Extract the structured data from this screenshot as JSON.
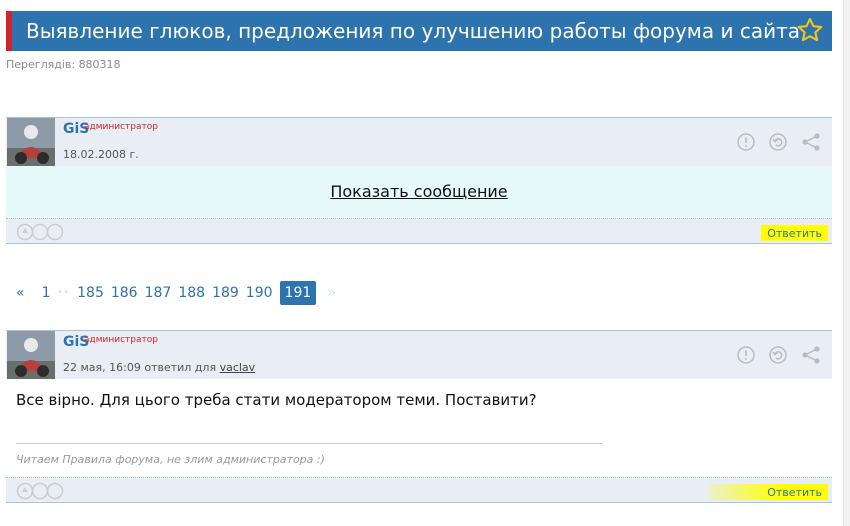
{
  "topic": {
    "title": "Выявление глюков, предложения по улучшению работы форума и сайта",
    "views_label": "Переглядів: 880318"
  },
  "posts": [
    {
      "author": "GiS",
      "role": "администратор",
      "date": "18.02.2008 г.",
      "show_message": "Показать сообщение",
      "reply_label": "Ответить"
    },
    {
      "author": "GiS",
      "role": "администратор",
      "date_prefix": "22 мая, 16:09 ответил для",
      "reply_to": "vaclav",
      "text": "Все вірно. Для цього треба стати модератором теми. Поставити?",
      "signature": "Читаем Правила форума, не злим администратора :)",
      "reply_label": "Ответить"
    }
  ],
  "pager": {
    "prev": "«",
    "first": "1",
    "ellipsis": "••",
    "pages": [
      "185",
      "186",
      "187",
      "188",
      "189",
      "190"
    ],
    "current": "191",
    "next": "»"
  },
  "colors": {
    "accent": "#2d73ad",
    "marker": "#d0232d",
    "highlight": "#ffff00"
  }
}
